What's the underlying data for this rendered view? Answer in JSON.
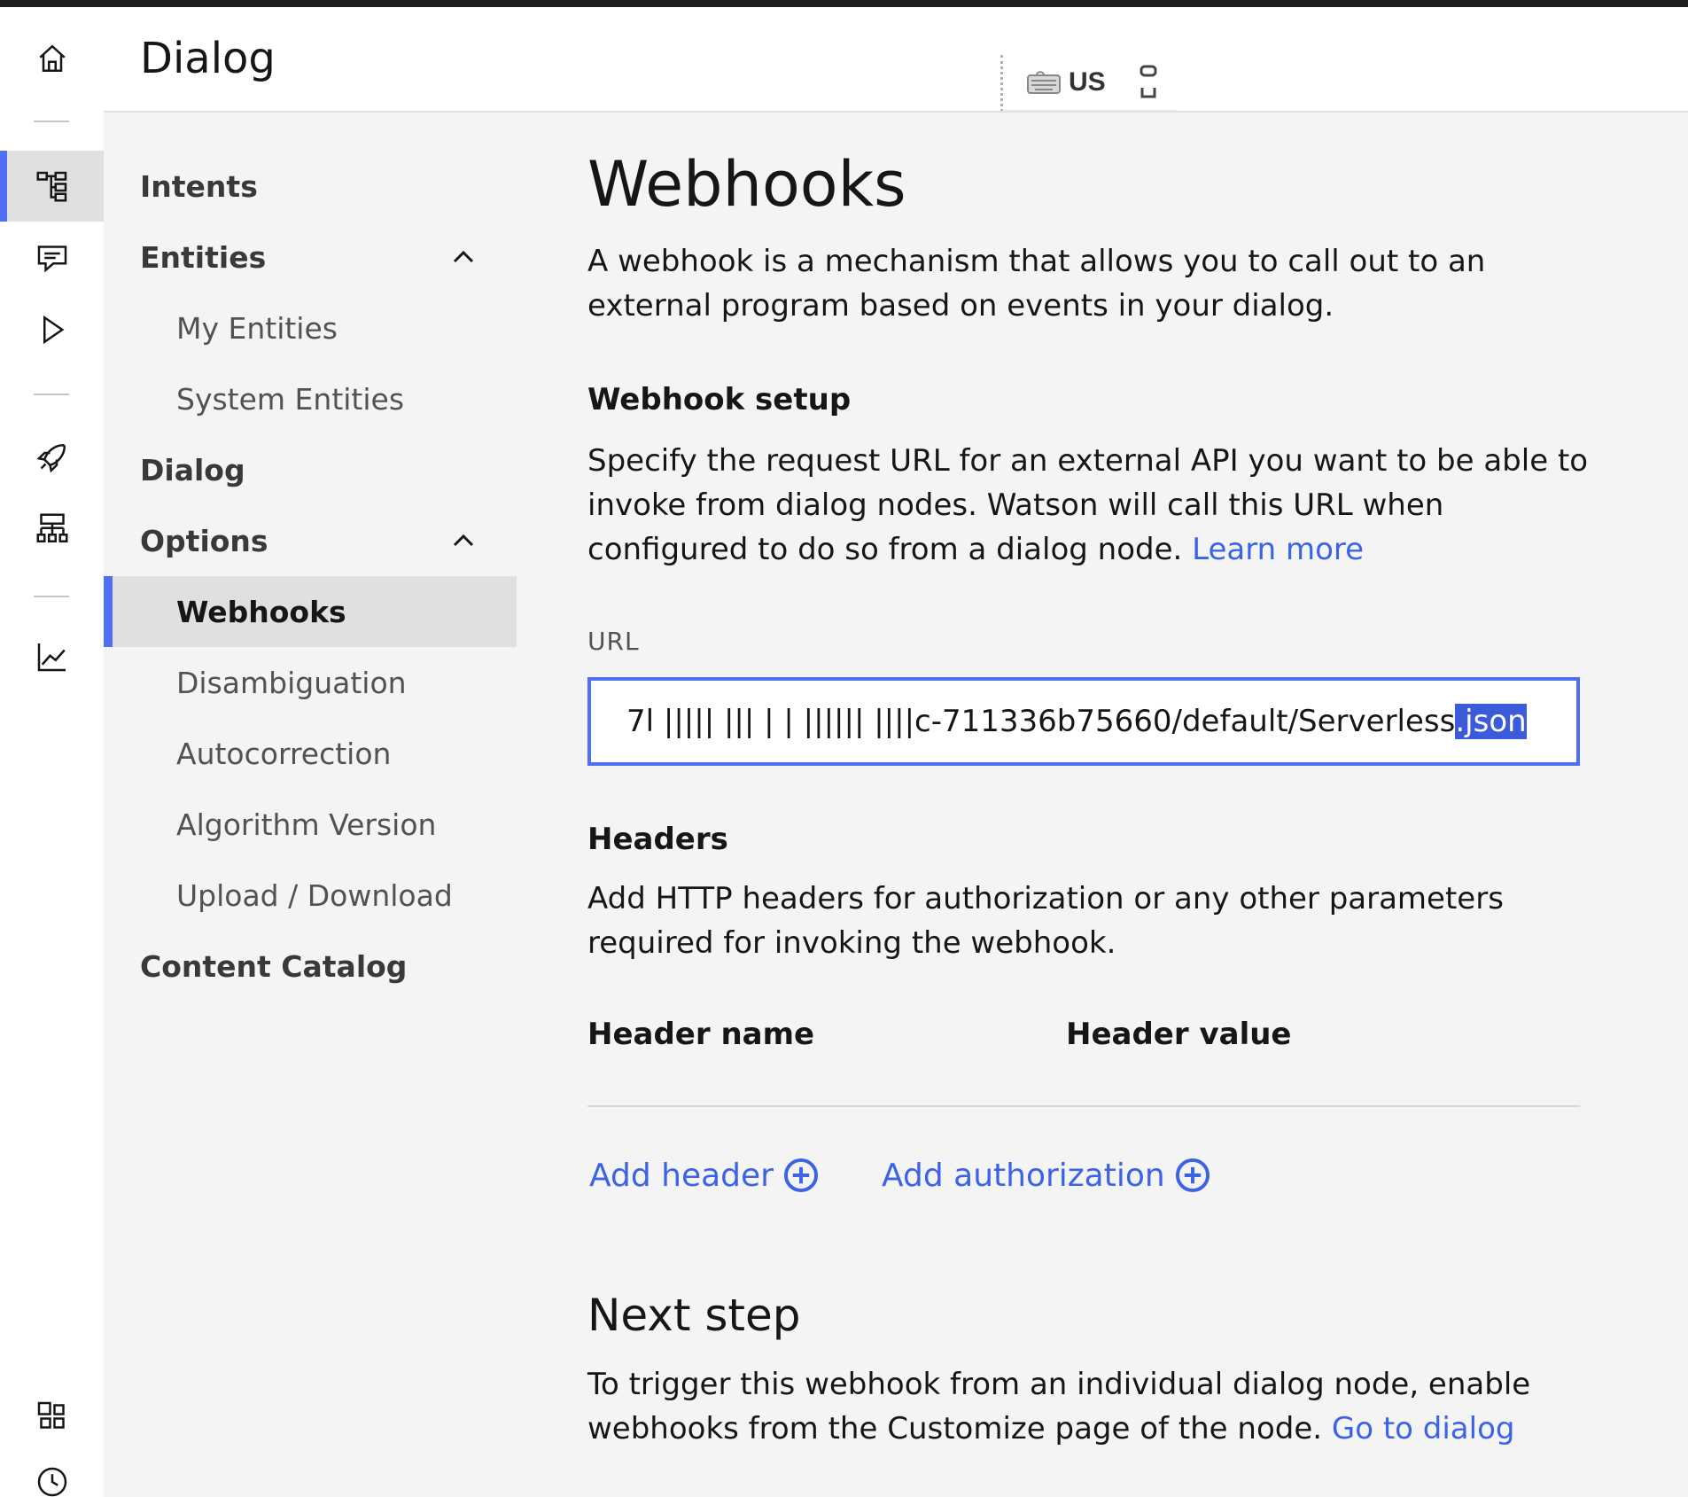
{
  "header": {
    "title": "Dialog",
    "keyboard": {
      "icon": "keyboard-icon",
      "lang": "US",
      "extra_icon": "resize-icon"
    }
  },
  "rail": {
    "items": [
      {
        "icon": "home-icon"
      },
      {
        "icon": "tree-icon",
        "active": true
      },
      {
        "icon": "chat-icon"
      },
      {
        "icon": "play-icon"
      },
      {
        "icon": "rocket-icon"
      },
      {
        "icon": "hierarchy-icon"
      },
      {
        "icon": "analytics-icon"
      },
      {
        "icon": "apps-icon"
      },
      {
        "icon": "clock-icon"
      }
    ]
  },
  "subnav": {
    "intents": "Intents",
    "entities": "Entities",
    "my_entities": "My Entities",
    "system_entities": "System Entities",
    "dialog": "Dialog",
    "options": "Options",
    "webhooks": "Webhooks",
    "disambiguation": "Disambiguation",
    "autocorrection": "Autocorrection",
    "algorithm_version": "Algorithm Version",
    "upload_download": "Upload / Download",
    "content_catalog": "Content Catalog"
  },
  "main": {
    "title": "Webhooks",
    "intro": "A webhook is a mechanism that allows you to call out to an external program based on events in your dialog.",
    "setup_heading": "Webhook setup",
    "setup_text": "Specify the request URL for an external API you want to be able to invoke from dialog nodes. Watson will call this URL when configured to do so from a dialog node.",
    "learn_more": "Learn more",
    "url_label": "URL",
    "url_value_prefix": "7l ||||| ||| | | |||||| ||||c-711336b75660/default/Serverless",
    "url_value_selected": ".json",
    "headers_heading": "Headers",
    "headers_text": "Add HTTP headers for authorization or any other parameters required for invoking the webhook.",
    "col_header_name": "Header name",
    "col_header_value": "Header value",
    "add_header": "Add header",
    "add_authorization": "Add authorization",
    "next_heading": "Next step",
    "next_text": "To trigger this webhook from an individual dialog node, enable webhooks from the Customize page of the node.",
    "go_to_dialog": "Go to dialog"
  }
}
